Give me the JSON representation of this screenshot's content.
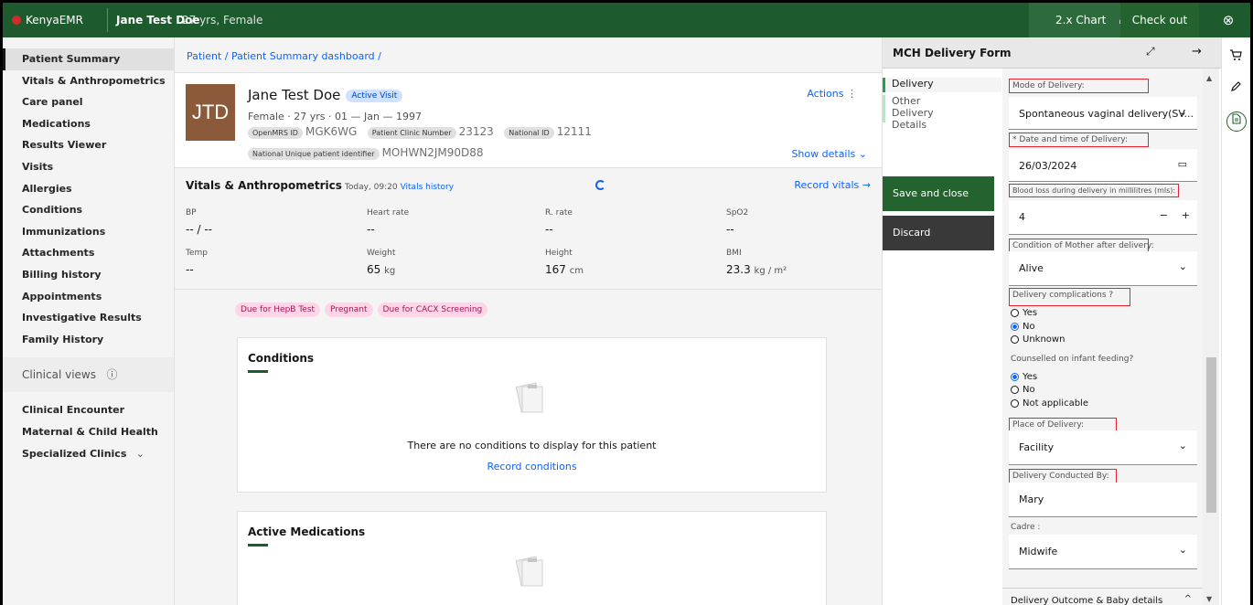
{
  "header": {
    "logo_text": "KenyaEMR",
    "patient_name": "Jane Test Doe",
    "patient_info": "27 yrs, Female",
    "chart_label": "2.x Chart",
    "home_icon": "⌂",
    "checkout_label": "Check out",
    "close_icon": "⊗"
  },
  "sidebar": {
    "items": [
      {
        "label": "Patient Summary"
      },
      {
        "label": "Vitals & Anthropometrics"
      },
      {
        "label": "Care panel"
      },
      {
        "label": "Medications"
      },
      {
        "label": "Results Viewer"
      },
      {
        "label": "Visits"
      },
      {
        "label": "Allergies"
      },
      {
        "label": "Conditions"
      },
      {
        "label": "Immunizations"
      },
      {
        "label": "Attachments"
      },
      {
        "label": "Billing history"
      },
      {
        "label": "Appointments"
      },
      {
        "label": "Investigative Results"
      },
      {
        "label": "Family History"
      }
    ],
    "section_label": "Clinical views",
    "info_icon": "ⓘ",
    "extra": [
      {
        "label": "Clinical Encounter"
      },
      {
        "label": "Maternal & Child Health",
        "chevron": "⌄"
      },
      {
        "label": "Specialized Clinics",
        "chevron": "⌄"
      }
    ]
  },
  "breadcrumb": "Patient  /  Patient Summary dashboard  /",
  "banner": {
    "initials": "JTD",
    "name": "Jane Test Doe",
    "visit_tag": "Active Visit",
    "demographics": "Female · 27 yrs · 01 — Jan — 1997",
    "ids": [
      {
        "tag": "OpenMRS ID",
        "value": "MGK6WG"
      },
      {
        "tag": "Patient Clinic Number",
        "value": "23123"
      },
      {
        "tag": "National ID",
        "value": "12111"
      }
    ],
    "nupi_tag": "National Unique patient identifier",
    "nupi_value": "MOHWN2JM90D88",
    "actions": "Actions  ⋮",
    "show_details": "Show details  ⌄"
  },
  "vitals": {
    "title": "Vitals & Anthropometrics",
    "when": "Today, 09:20",
    "history_link": "Vitals history",
    "record_link": "Record vitals  →",
    "cells": [
      {
        "label": "BP",
        "value": "-- / --",
        "unit": ""
      },
      {
        "label": "Heart rate",
        "value": "--",
        "unit": ""
      },
      {
        "label": "R. rate",
        "value": "--",
        "unit": ""
      },
      {
        "label": "SpO2",
        "value": "--",
        "unit": ""
      },
      {
        "label": "Temp",
        "value": "--",
        "unit": ""
      },
      {
        "label": "Weight",
        "value": "65",
        "unit": "kg"
      },
      {
        "label": "Height",
        "value": "167",
        "unit": "cm"
      },
      {
        "label": "BMI",
        "value": "23.3",
        "unit": "kg / m²"
      }
    ]
  },
  "flags": [
    "Due for HepB Test",
    "Pregnant",
    "Due for CACX Screening"
  ],
  "conditions_card": {
    "title": "Conditions",
    "empty": "There are no conditions to display for this patient",
    "link": "Record conditions"
  },
  "medications_card": {
    "title": "Active Medications"
  },
  "workspace": {
    "title": "MCH Delivery Form",
    "maximize_icon": "⤢",
    "collapse_icon": "→",
    "tabs": [
      "Delivery",
      "Other Delivery Details"
    ],
    "save_label": "Save and close",
    "discard_label": "Discard",
    "form": {
      "mode_label": "Mode of Delivery:",
      "mode_value": "Spontaneous vaginal delivery(SV...",
      "date_label": "* Date and time of Delivery:",
      "date_value": "26/03/2024",
      "blood_label": "Blood loss during delivery in millilitres (mls):",
      "blood_value": "4",
      "condition_label": "Condition of Mother after delivery:",
      "condition_value": "Alive",
      "complications_label": "Delivery complications ?",
      "complications_options": [
        "Yes",
        "No",
        "Unknown"
      ],
      "counselled_label": "Counselled on infant feeding?",
      "counselled_options": [
        "Yes",
        "No",
        "Not applicable"
      ],
      "place_label": "Place of Delivery:",
      "place_value": "Facility",
      "conducted_label": "Delivery Conducted By:",
      "conducted_value": "Mary",
      "cadre_label": "Cadre :",
      "cadre_value": "Midwife",
      "outcome_label": "Delivery Outcome & Baby details"
    }
  },
  "rail": {
    "cart_icon": "🛒",
    "pen_icon": "✎",
    "form_icon": "🗎"
  }
}
